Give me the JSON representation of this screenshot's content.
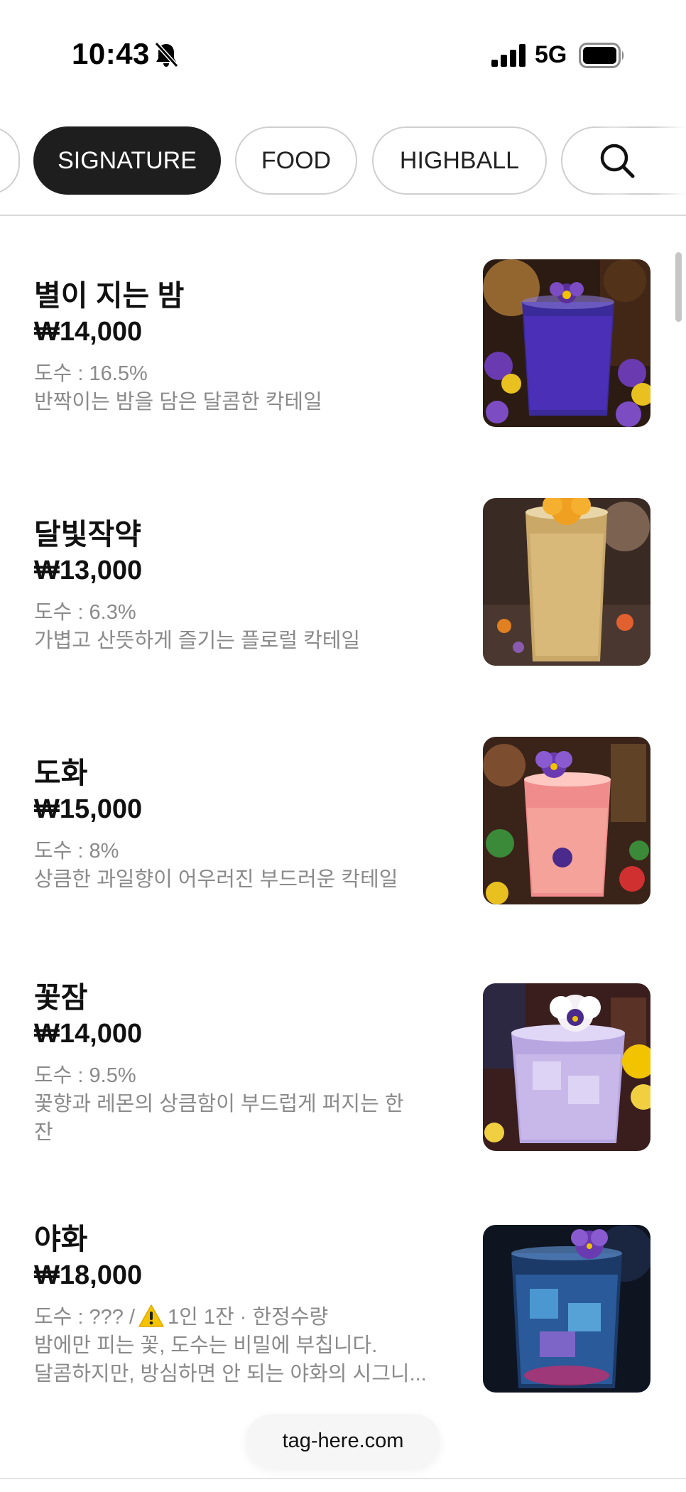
{
  "status_bar": {
    "time": "10:43",
    "network": "5G",
    "icons": [
      "bell-slash-icon",
      "cellular-signal-icon",
      "battery-icon"
    ]
  },
  "categories": {
    "items": [
      {
        "label": "SIGNATURE",
        "active": true
      },
      {
        "label": "FOOD",
        "active": false
      },
      {
        "label": "HIGHBALL",
        "active": false
      }
    ],
    "search_icon": "search-icon"
  },
  "menu": {
    "items": [
      {
        "name": "별이 지는 밤",
        "price": "₩14,000",
        "abv": "도수 : 16.5%",
        "description": "반짝이는 밤을 담은 달콤한 칵테일"
      },
      {
        "name": "달빛작약",
        "price": "₩13,000",
        "abv": "도수 : 6.3%",
        "description": "가볍고 산뜻하게 즐기는 플로럴 칵테일"
      },
      {
        "name": "도화",
        "price": "₩15,000",
        "abv": "도수 : 8%",
        "description": "상큼한 과일향이 어우러진 부드러운 칵테일"
      },
      {
        "name": "꽃잠",
        "price": "₩14,000",
        "abv": "도수 : 9.5%",
        "description_line1": "꽃향과 레몬의 상큼함이 부드럽게 퍼지는 한",
        "description_line2": "잔"
      },
      {
        "name": "야화",
        "price": "₩18,000",
        "abv_prefix": "도수 : ??? /",
        "abv_notice": "1인 1잔 · 한정수량",
        "description_line1": "밤에만 피는 꽃, 도수는 비밀에 부칩니다.",
        "description_line2": "달콤하지만, 방심하면 안 되는 야화의 시그니..."
      }
    ]
  },
  "footer": {
    "domain": "tag-here.com"
  },
  "colors": {
    "active_chip_bg": "#1e1e1e",
    "chip_border": "#cfcfcf",
    "muted_text": "#8a8a8a",
    "warning": "#f5c400"
  }
}
